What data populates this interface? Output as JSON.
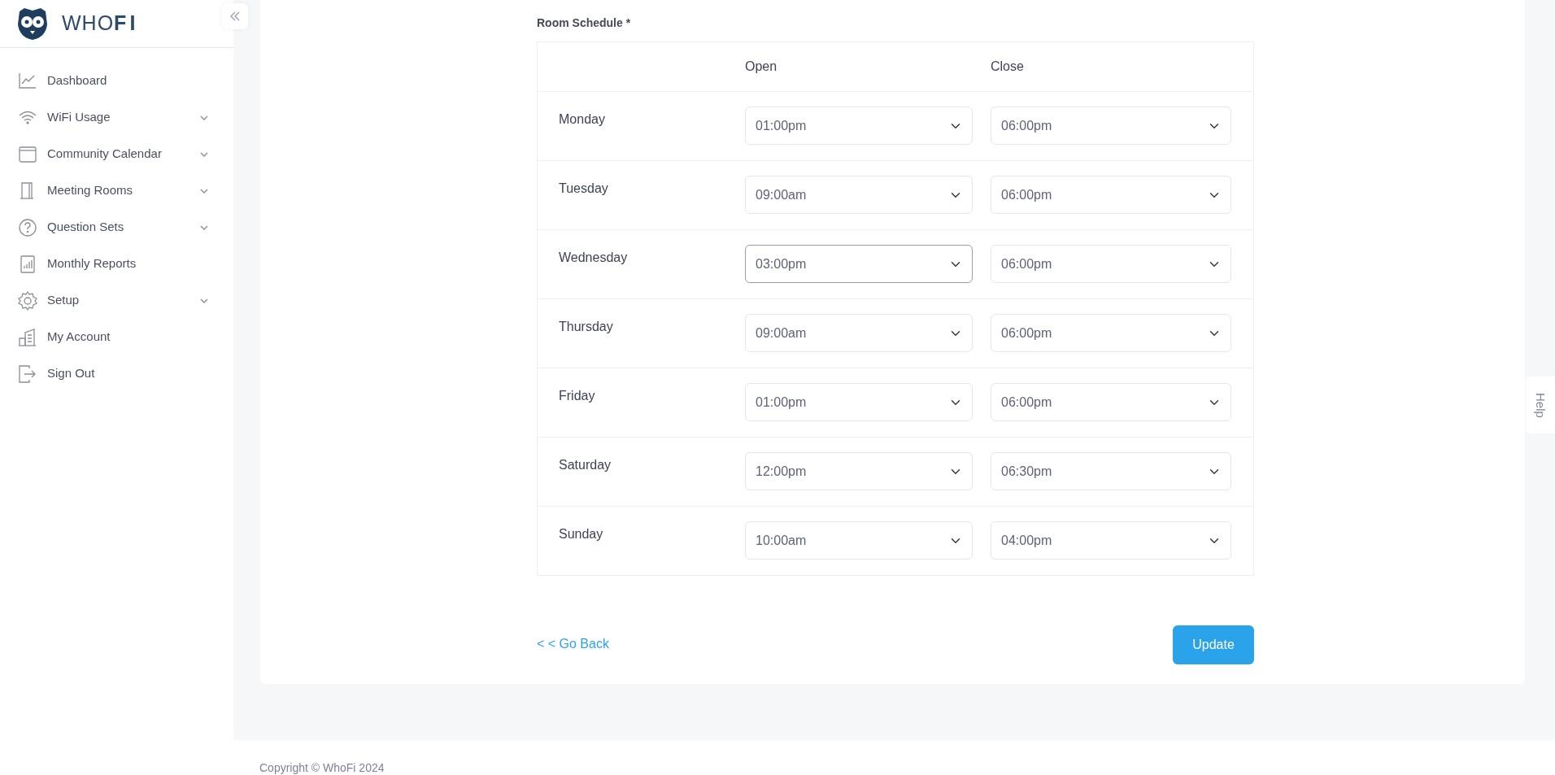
{
  "brand": {
    "name": "WHO**FI**"
  },
  "sidebar": {
    "items": [
      {
        "label": "Dashboard",
        "has_submenu": false
      },
      {
        "label": "WiFi Usage",
        "has_submenu": true
      },
      {
        "label": "Community Calendar",
        "has_submenu": true
      },
      {
        "label": "Meeting Rooms",
        "has_submenu": true
      },
      {
        "label": "Question Sets",
        "has_submenu": true
      },
      {
        "label": "Monthly Reports",
        "has_submenu": false
      },
      {
        "label": "Setup",
        "has_submenu": true
      },
      {
        "label": "My Account",
        "has_submenu": false
      },
      {
        "label": "Sign Out",
        "has_submenu": false
      }
    ]
  },
  "schedule": {
    "label": "Room Schedule *",
    "columns": [
      "Open",
      "Close"
    ],
    "rows": [
      {
        "day": "Monday",
        "open": "01:00pm",
        "close": "06:00pm",
        "open_focused": false
      },
      {
        "day": "Tuesday",
        "open": "09:00am",
        "close": "06:00pm",
        "open_focused": false
      },
      {
        "day": "Wednesday",
        "open": "03:00pm",
        "close": "06:00pm",
        "open_focused": true
      },
      {
        "day": "Thursday",
        "open": "09:00am",
        "close": "06:00pm",
        "open_focused": false
      },
      {
        "day": "Friday",
        "open": "01:00pm",
        "close": "06:00pm",
        "open_focused": false
      },
      {
        "day": "Saturday",
        "open": "12:00pm",
        "close": "06:30pm",
        "open_focused": false
      },
      {
        "day": "Sunday",
        "open": "10:00am",
        "close": "04:00pm",
        "open_focused": false
      }
    ]
  },
  "go_back": "< < Go Back",
  "update_button": "Update",
  "help_tab": "Help",
  "footer": {
    "copyright": "Copyright ©  WhoFi 2024"
  }
}
